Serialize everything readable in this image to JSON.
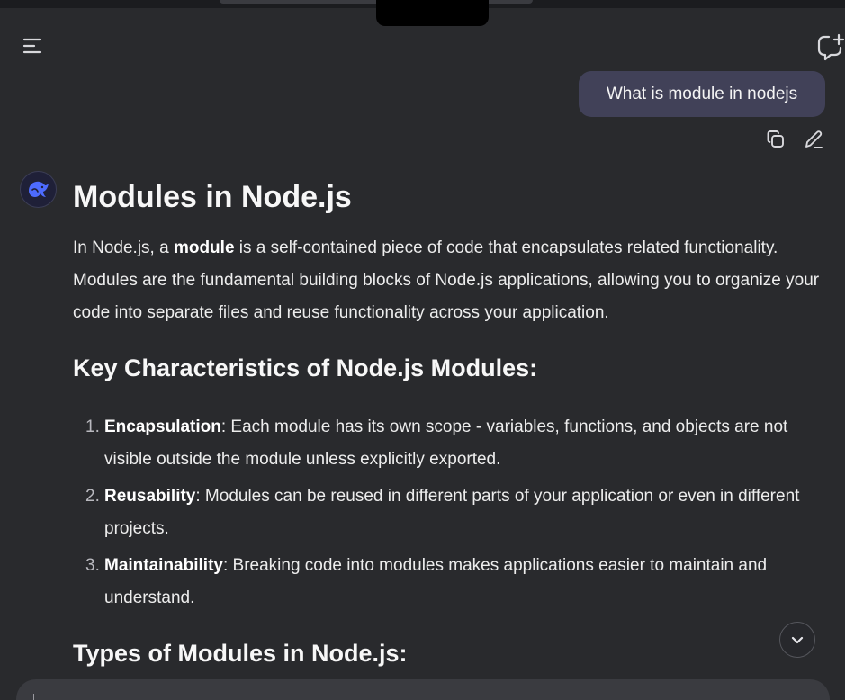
{
  "header": {
    "menu_icon": "hamburger-menu-icon",
    "new_chat_icon": "new-chat-bubble-icon"
  },
  "user_message": {
    "text": "What is module in nodejs",
    "actions": {
      "copy_icon": "copy-icon",
      "edit_icon": "pencil-edit-icon"
    }
  },
  "assistant": {
    "avatar_icon": "whale-logo-icon",
    "title": "Modules in Node.js",
    "intro": {
      "prefix": "In Node.js, a ",
      "bold": "module",
      "suffix": " is a self-contained piece of code that encapsulates related functionality. Modules are the fundamental building blocks of Node.js applications, allowing you to organize your code into separate files and reuse functionality across your application."
    },
    "section1_title": "Key Characteristics of Node.js Modules:",
    "characteristics": [
      {
        "num": "1.",
        "term": "Encapsulation",
        "text": ": Each module has its own scope - variables, functions, and objects are not visible outside the module unless explicitly exported."
      },
      {
        "num": "2.",
        "term": "Reusability",
        "text": ": Modules can be reused in different parts of your application or even in different projects."
      },
      {
        "num": "3.",
        "term": "Maintainability",
        "text": ": Breaking code into modules makes applications easier to maintain and understand."
      }
    ],
    "section2_title": "Types of Modules in Node.js:"
  },
  "controls": {
    "scroll_down_icon": "chevron-down-icon"
  },
  "colors": {
    "background": "#292a2d",
    "user_bubble": "#414158",
    "accent": "#4d6bfe"
  }
}
